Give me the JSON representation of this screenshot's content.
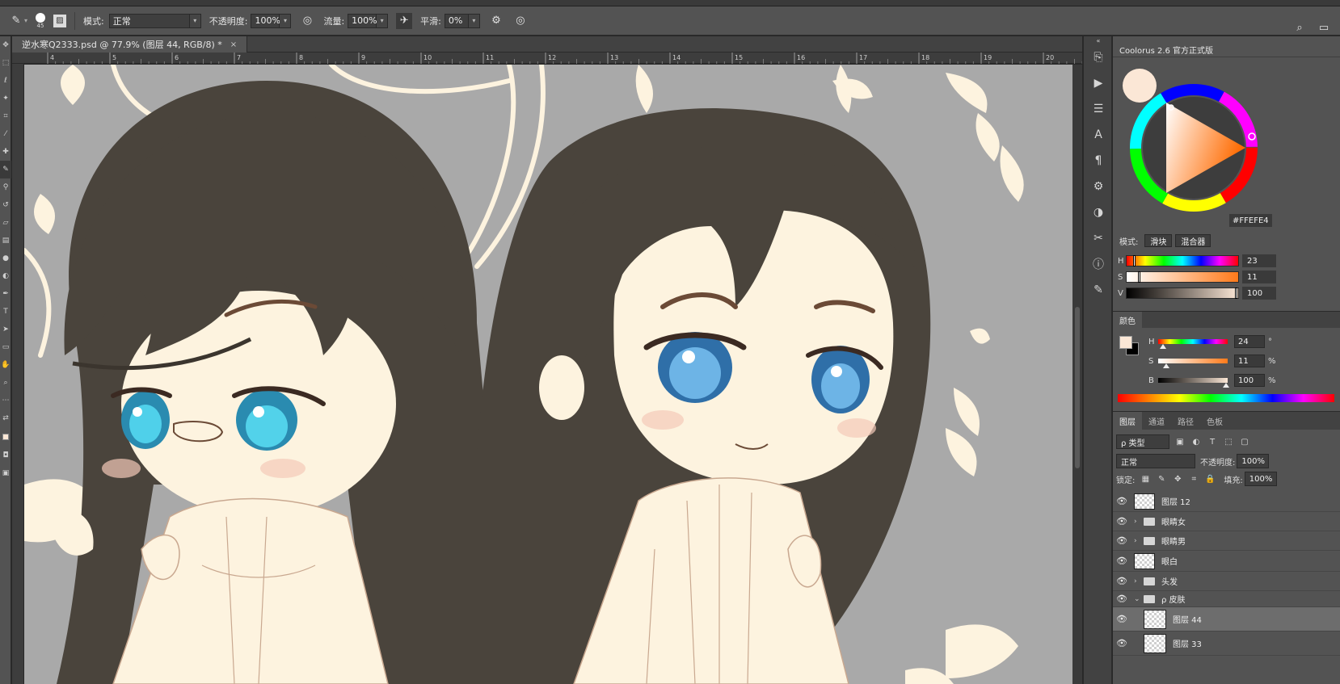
{
  "options_bar": {
    "brush_size": "45",
    "mode_label": "模式:",
    "mode_value": "正常",
    "opacity_label": "不透明度:",
    "opacity_value": "100%",
    "flow_label": "流量:",
    "flow_value": "100%",
    "smooth_label": "平滑:",
    "smooth_value": "0%"
  },
  "document": {
    "tab_title": "逆水寒Q2333.psd @ 77.9% (图层 44, RGB/8) *",
    "tab_close": "×"
  },
  "ruler": {
    "ticks": [
      "4",
      "5",
      "6",
      "7",
      "8",
      "9",
      "10",
      "11",
      "12",
      "13",
      "14",
      "15",
      "16",
      "17",
      "18",
      "19",
      "20"
    ]
  },
  "coolorus": {
    "title": "Coolorus 2.6 官方正式版",
    "hex": "#FFEFE4",
    "mode_label": "模式:",
    "mode_buttons": [
      "滑块",
      "混合器"
    ],
    "hsv": [
      {
        "label": "H",
        "value": "23"
      },
      {
        "label": "S",
        "value": "11"
      },
      {
        "label": "V",
        "value": "100"
      }
    ]
  },
  "color_panel": {
    "tab": "颜色",
    "rows": [
      {
        "label": "H",
        "value": "24",
        "unit": "°"
      },
      {
        "label": "S",
        "value": "11",
        "unit": "%"
      },
      {
        "label": "B",
        "value": "100",
        "unit": "%"
      }
    ]
  },
  "layers_panel": {
    "tabs": [
      "图层",
      "通道",
      "路径",
      "色板"
    ],
    "filter_kind": "ρ 类型",
    "blend_mode": "正常",
    "opacity_label": "不透明度:",
    "opacity_value": "100%",
    "lock_label": "锁定:",
    "fill_label": "填充:",
    "fill_value": "100%",
    "layers": [
      {
        "name": "图层 12",
        "type": "layer"
      },
      {
        "name": "眼睛女",
        "type": "group"
      },
      {
        "name": "眼睛男",
        "type": "group"
      },
      {
        "name": "眼白",
        "type": "layer"
      },
      {
        "name": "头发",
        "type": "group"
      },
      {
        "name": "ρ 皮肤",
        "type": "group-open"
      },
      {
        "name": "图层 44",
        "type": "layer",
        "selected": true
      },
      {
        "name": "图层 33",
        "type": "layer"
      }
    ]
  },
  "colors": {
    "canvas_bg": "#a9a9a9",
    "skin": "#fdf3df",
    "hair": "#4a443c",
    "foreground": "#fbe7d6"
  }
}
